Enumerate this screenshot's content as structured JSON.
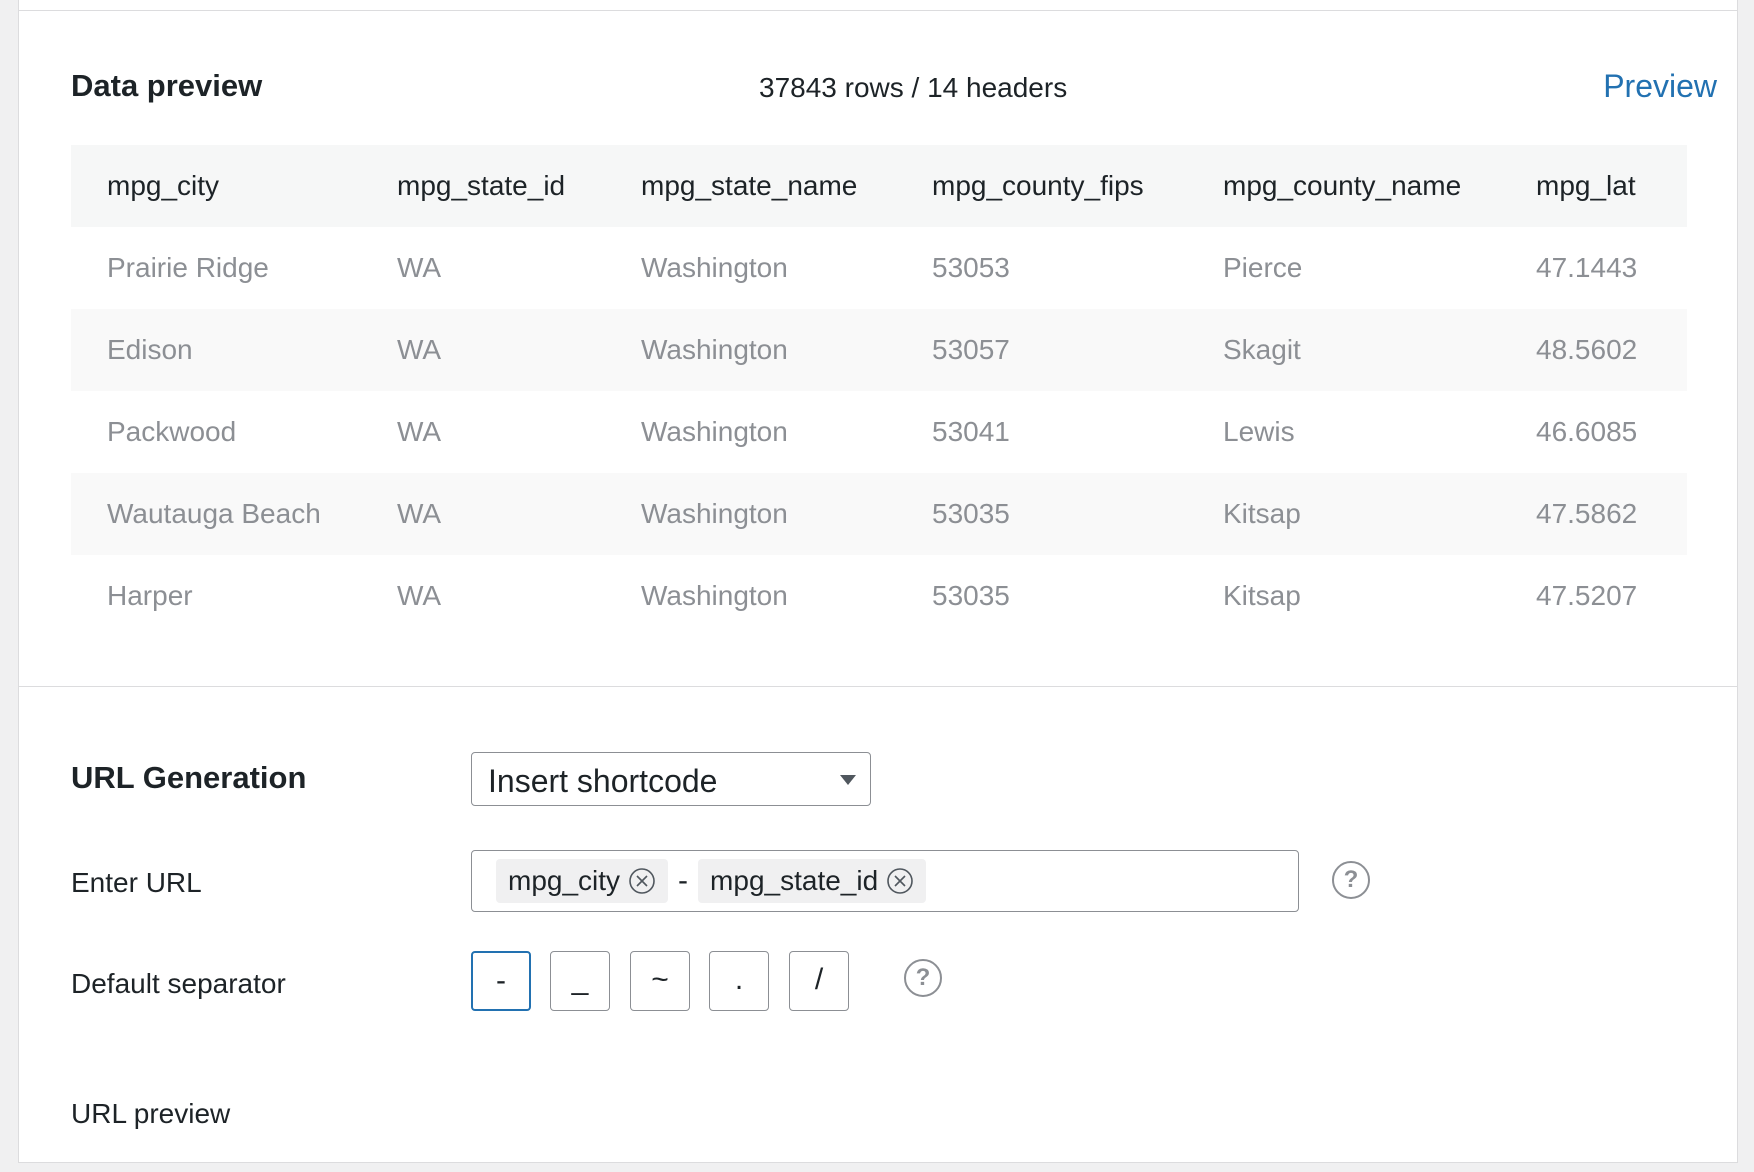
{
  "data_preview": {
    "title": "Data preview",
    "count": "37843 rows / 14 headers",
    "preview_link": "Preview",
    "columns": [
      "mpg_city",
      "mpg_state_id",
      "mpg_state_name",
      "mpg_county_fips",
      "mpg_county_name",
      "mpg_lat"
    ],
    "rows": [
      [
        "Prairie Ridge",
        "WA",
        "Washington",
        "53053",
        "Pierce",
        "47.1443"
      ],
      [
        "Edison",
        "WA",
        "Washington",
        "53057",
        "Skagit",
        "48.5602"
      ],
      [
        "Packwood",
        "WA",
        "Washington",
        "53041",
        "Lewis",
        "46.6085"
      ],
      [
        "Wautauga Beach",
        "WA",
        "Washington",
        "53035",
        "Kitsap",
        "47.5862"
      ],
      [
        "Harper",
        "WA",
        "Washington",
        "53035",
        "Kitsap",
        "47.5207"
      ]
    ]
  },
  "url_generation": {
    "title": "URL Generation",
    "select_value": "Insert shortcode",
    "enter_url_label": "Enter URL",
    "chips": [
      "mpg_city",
      "mpg_state_id"
    ],
    "chip_separator": "-",
    "default_separator_label": "Default separator",
    "separators": [
      "-",
      "_",
      "~",
      ".",
      "/"
    ],
    "active_separator_index": 0,
    "help_glyph": "?",
    "url_preview_label": "URL preview"
  },
  "icons": {
    "chip_remove": "circle-x-icon",
    "help": "question-circle-icon",
    "dropdown": "caret-down-icon"
  },
  "colors": {
    "link": "#2271b1",
    "border": "#8c8f94",
    "muted_text": "#8c8f94"
  }
}
